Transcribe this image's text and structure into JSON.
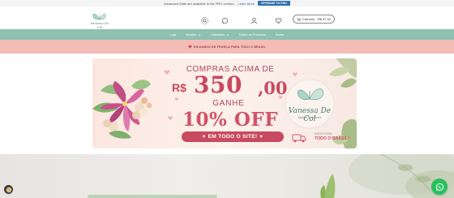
{
  "notice": {
    "text": "Advanced Slats are available in the PRO version.",
    "learn_more": "Learn More",
    "upgrade": "UPGRADE TO PRO"
  },
  "header": {
    "logo_text": "Vanessa De Col",
    "icons": [
      {
        "name": "search-icon",
        "label": ""
      },
      {
        "name": "whatsapp-icon",
        "label": "Atendimento"
      },
      {
        "name": "user-icon",
        "label": "Minha conta"
      },
      {
        "name": "heart-icon",
        "label": "Desejos"
      }
    ],
    "cart_label": "Carrinho · R$ 57,42"
  },
  "nav": {
    "items": [
      {
        "label": "Loja",
        "dropdown": false
      },
      {
        "label": "Moldes",
        "dropdown": true
      },
      {
        "label": "Coleções",
        "dropdown": true
      },
      {
        "label": "Todos os Produtos",
        "dropdown": false
      },
      {
        "label": "Sobre",
        "dropdown": false
      }
    ]
  },
  "shipping_banner": {
    "text": "ENVIAMOS DE FRANÇA PARA TODO O BRASIL"
  },
  "promo": {
    "line1": "COMPRAS ACIMA DE",
    "currency": "R$",
    "amount": "350",
    "cents": ",00",
    "ganhe": "GANHE",
    "discount": "10% OFF",
    "site_text": "EM TODO O SITE!",
    "brand_name": "Vanessa De Col",
    "brand_sub": "Moldes de Silicone",
    "envio_line1": "ENVIO PARA",
    "envio_line2": "TODO O BRASIL!"
  },
  "colors": {
    "nav_bg": "#8fc1b2",
    "ship_bg": "#f4bcb6",
    "accent_pink": "#c8495f",
    "whatsapp": "#25c15e"
  }
}
